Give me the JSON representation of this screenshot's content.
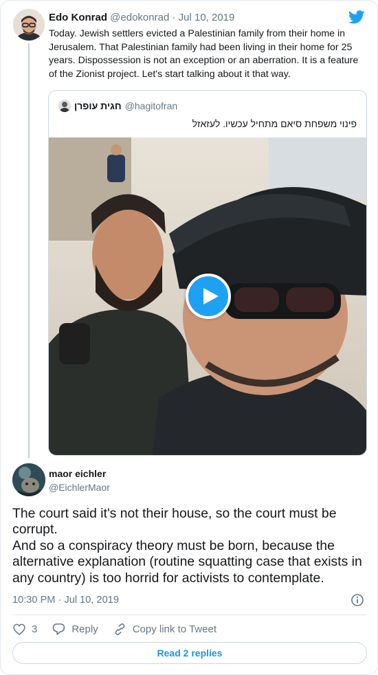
{
  "parent_tweet": {
    "name": "Edo Konrad",
    "handle": "@edokonrad",
    "date": "Jul 10, 2019",
    "separator": " · ",
    "text": "Today. Jewish settlers evicted a Palestinian family from their home in Jerusalem. That Palestinian family had been living in their home for 25 years. Dispossession is not an exception or an aberration. It is a feature of the Zionist project. Let's start talking about it that way."
  },
  "quoted_tweet": {
    "name": "חגית עופרן",
    "handle": "@hagitofran",
    "text": "פינוי משפחת סיאם מתחיל עכשיו. לעזאזל"
  },
  "reply": {
    "name": "maor eichler",
    "handle": "@EichlerMaor",
    "text_lines": [
      "The court said it's not their house, so the court must be corrupt.",
      "And so a conspiracy theory must be born, because the alternative explanation (routine squatting case that exists in any country) is too horrid for activists to contemplate."
    ],
    "time": "10:30 PM",
    "date": "Jul 10, 2019",
    "separator": " · "
  },
  "actions": {
    "like_count": "3",
    "reply_label": "Reply",
    "copy_link_label": "Copy link to Tweet"
  },
  "footer": {
    "read_replies_label": "Read 2 replies"
  },
  "colors": {
    "twitter_blue": "#1da1f2",
    "link_blue": "#1b95e0",
    "secondary_text": "#657786",
    "border": "#e1e8ed"
  },
  "icons": [
    "twitter-bird-icon",
    "play-icon",
    "info-icon",
    "heart-icon",
    "reply-bubble-icon",
    "link-icon"
  ]
}
